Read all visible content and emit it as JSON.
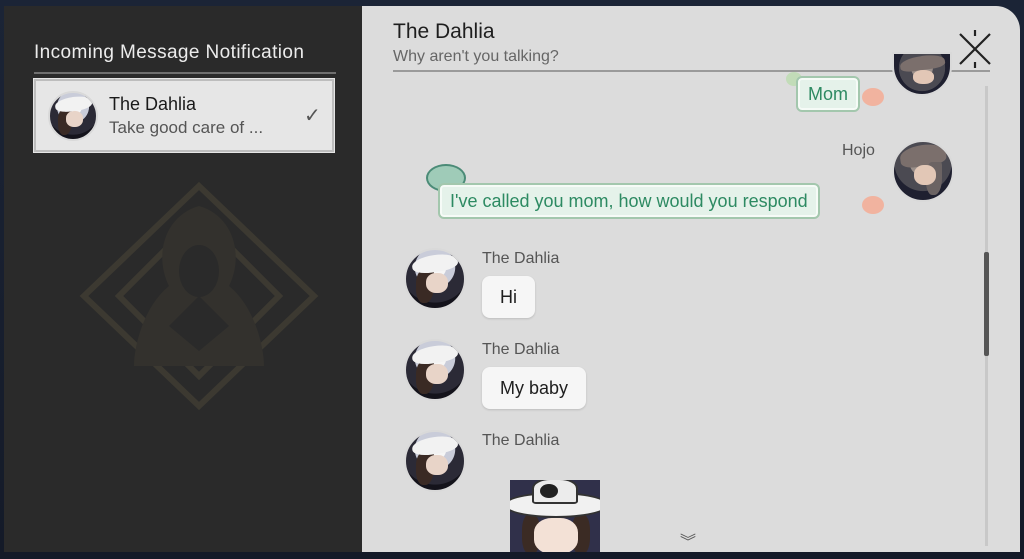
{
  "sidebar": {
    "title": "Incoming Message Notification",
    "contacts": [
      {
        "name": "The Dahlia",
        "preview": "Take good care of ...",
        "status_icon": "checkmark-icon"
      }
    ]
  },
  "chat": {
    "title": "The Dahlia",
    "subtitle": "Why aren't you talking?",
    "messages": [
      {
        "sender": "",
        "text": "Mom",
        "side": "right",
        "style": "option"
      },
      {
        "sender": "Hojo",
        "text": "I've called you mom, how would you respond",
        "side": "right",
        "style": "option"
      },
      {
        "sender": "The Dahlia",
        "text": "Hi",
        "side": "left",
        "style": "bubble"
      },
      {
        "sender": "The Dahlia",
        "text": "My baby",
        "side": "left",
        "style": "bubble"
      },
      {
        "sender": "The Dahlia",
        "text": "",
        "side": "left",
        "style": "sticker"
      }
    ]
  },
  "icons": {
    "close": "close-x-icon",
    "scroll_down": "double-chevron-down-icon",
    "check": "checkmark-icon"
  },
  "colors": {
    "option_text": "#2d8a62",
    "option_border": "#a3c7ad",
    "panel_dark": "#2a2a2a",
    "panel_light": "#dcdcdc"
  }
}
